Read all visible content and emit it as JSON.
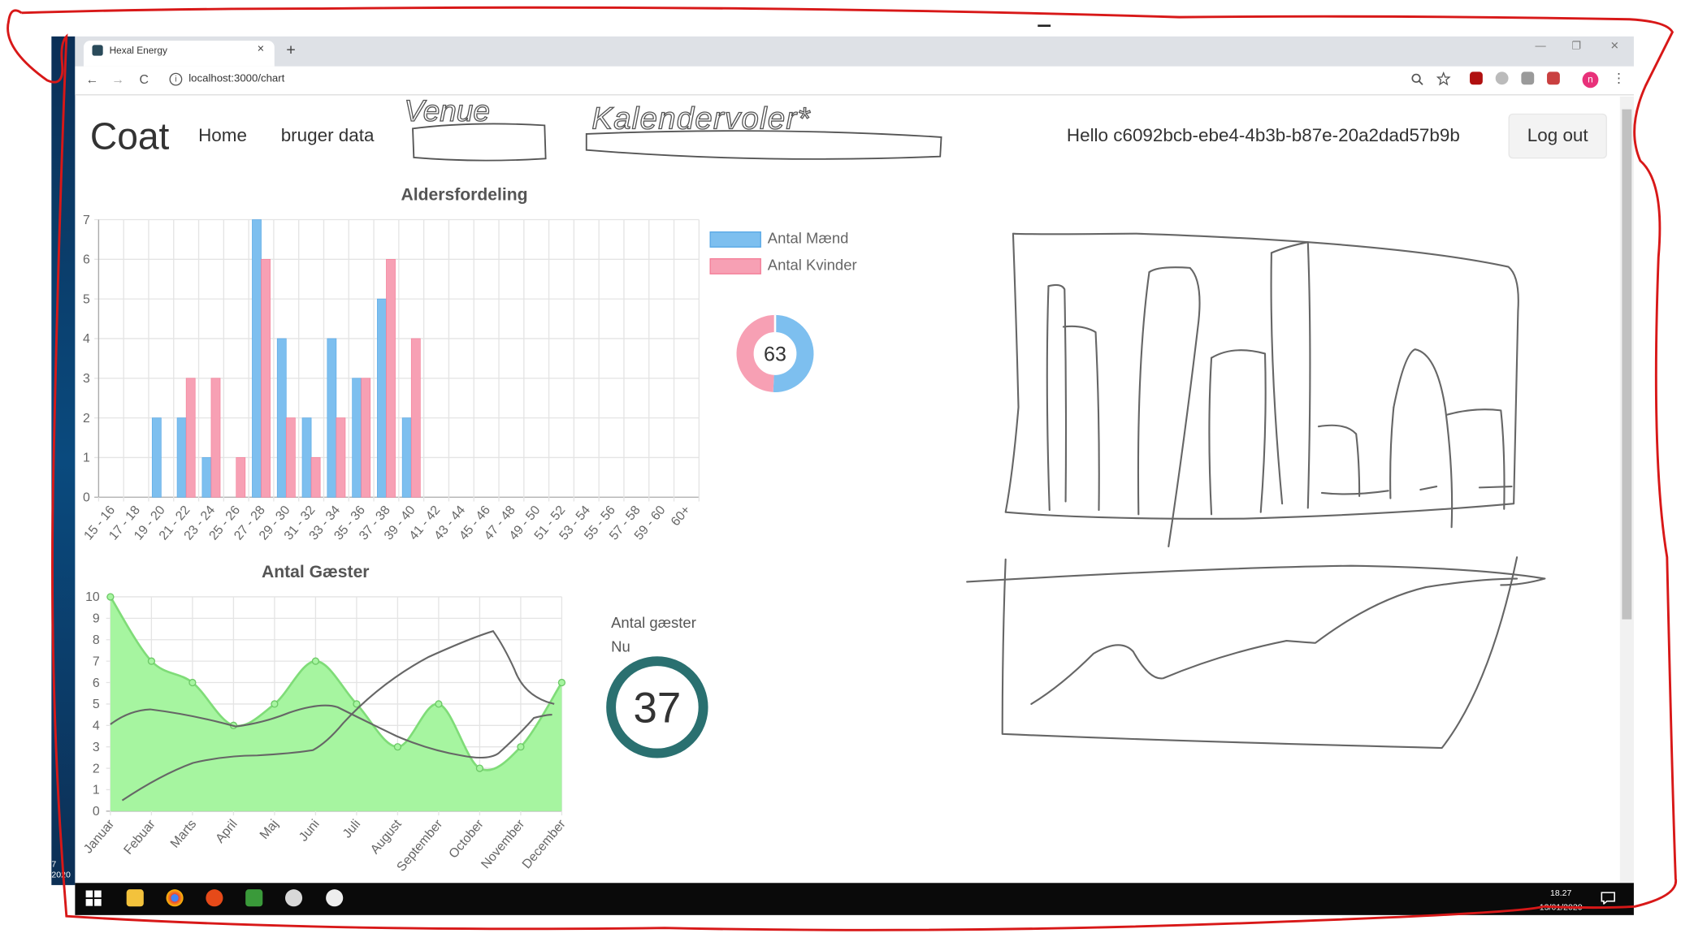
{
  "browser": {
    "tab_title": "Hexal Energy",
    "tab_close": "×",
    "new_tab": "+",
    "url": "localhost:3000/chart",
    "window_min": "—",
    "window_max": "❐",
    "window_close": "✕",
    "profile_initial": "n",
    "menu": "⋮",
    "back": "←",
    "forward": "→",
    "reload": "C",
    "info": "i",
    "zoom_icon": "zoom-icon",
    "star_icon": "star-icon"
  },
  "navbar": {
    "brand": "Coat",
    "links": [
      "Home",
      "bruger data"
    ],
    "sketch_venue": "Venue",
    "sketch_calendar": "Kalendervoler*",
    "greeting": "Hello c6092bcb-ebe4-4b3b-b87e-20a2dad57b9b",
    "logout": "Log out"
  },
  "guests": {
    "label_line1": "Antal gæster",
    "label_line2": "Nu",
    "count": 37,
    "ring_color": "#2a7070"
  },
  "desktop": {
    "clock_time": "18.27",
    "clock_date": "13/01/2020",
    "left_clock_a": "7",
    "left_clock_b": "2020"
  },
  "colors": {
    "male": "#7dbfef",
    "female": "#f7a0b4",
    "guests_fill": "#a6f5a0",
    "annotation_red": "#d81818"
  },
  "chart_data": [
    {
      "type": "bar",
      "title": "Aldersfordeling",
      "categories": [
        "15 - 16",
        "17 - 18",
        "19 - 20",
        "21 - 22",
        "23 - 24",
        "25 - 26",
        "27 - 28",
        "29 - 30",
        "31 - 32",
        "33 - 34",
        "35 - 36",
        "37 - 38",
        "39 - 40",
        "41 - 42",
        "43 - 44",
        "45 - 46",
        "47 - 48",
        "49 - 50",
        "51 - 52",
        "53 - 54",
        "55 - 56",
        "57 - 58",
        "59 - 60",
        "60+"
      ],
      "series": [
        {
          "name": "Antal Mænd",
          "values": [
            0,
            0,
            2,
            2,
            1,
            0,
            7,
            4,
            2,
            4,
            3,
            5,
            2,
            0,
            0,
            0,
            0,
            0,
            0,
            0,
            0,
            0,
            0,
            0
          ]
        },
        {
          "name": "Antal Kvinder",
          "values": [
            0,
            0,
            0,
            3,
            3,
            1,
            6,
            2,
            1,
            2,
            3,
            6,
            4,
            0,
            0,
            0,
            0,
            0,
            0,
            0,
            0,
            0,
            0,
            0
          ]
        }
      ],
      "ylim": [
        0,
        7
      ],
      "yticks": [
        0,
        1,
        2,
        3,
        4,
        5,
        6,
        7
      ],
      "grid": true,
      "legend_position": "right"
    },
    {
      "type": "pie",
      "center_label": "63",
      "slices": [
        {
          "name": "Antal Mænd",
          "value": 32
        },
        {
          "name": "Antal Kvinder",
          "value": 31
        }
      ]
    },
    {
      "type": "area",
      "title": "Antal Gæster",
      "categories": [
        "Januar",
        "Febuar",
        "Marts",
        "April",
        "Maj",
        "Juni",
        "Juli",
        "August",
        "September",
        "October",
        "November",
        "December"
      ],
      "values": [
        10,
        7,
        6,
        4,
        5,
        7,
        5,
        3,
        5,
        2,
        3,
        6
      ],
      "ylim": [
        0,
        10
      ],
      "yticks": [
        0,
        1,
        2,
        3,
        4,
        5,
        6,
        7,
        8,
        9,
        10
      ],
      "grid": true
    }
  ]
}
